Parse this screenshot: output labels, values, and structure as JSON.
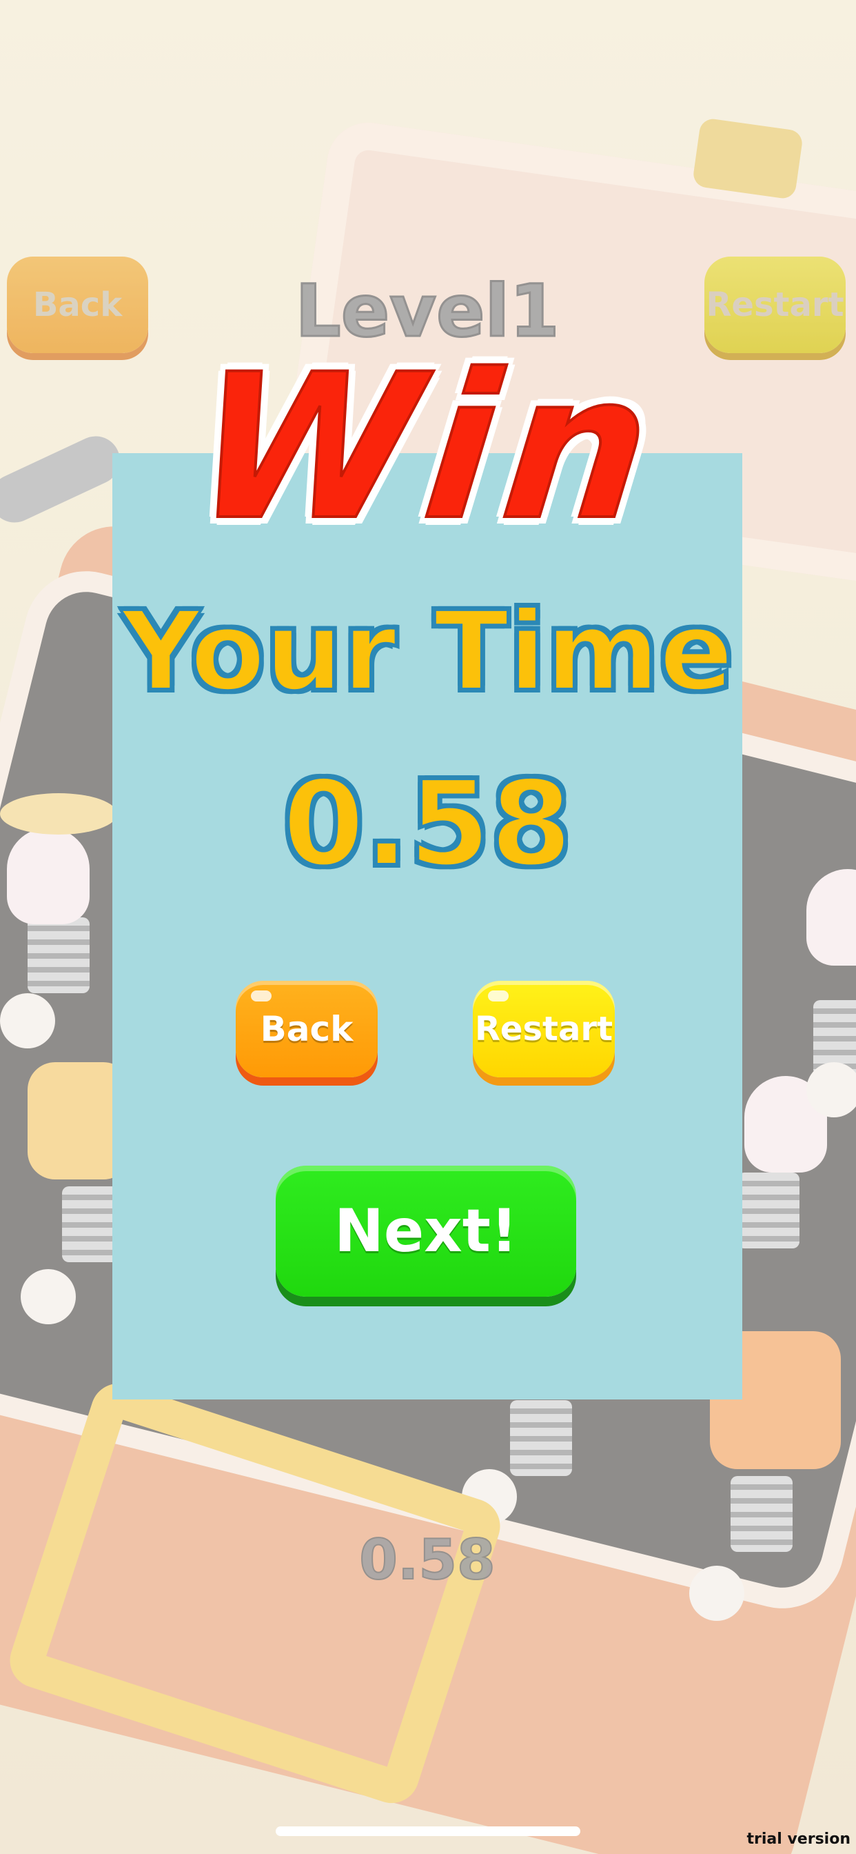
{
  "hud": {
    "back_label": "Back",
    "level_label": "Level1",
    "restart_label": "Restart"
  },
  "dialog": {
    "title": "Win",
    "time_label": "Your Time",
    "time_value": "0.58",
    "back_label": "Back",
    "restart_label": "Restart",
    "next_label": "Next!"
  },
  "footer": {
    "time_value": "0.58",
    "watermark": "trial version"
  },
  "colors": {
    "dialog_bg": "#a7dae0",
    "win_red": "#fa240b",
    "time_yellow": "#fcc10a",
    "outline_blue": "#2b88b6",
    "back_orange": "#ff9a06",
    "restart_yellow": "#ffd600",
    "next_green": "#20d80e"
  }
}
